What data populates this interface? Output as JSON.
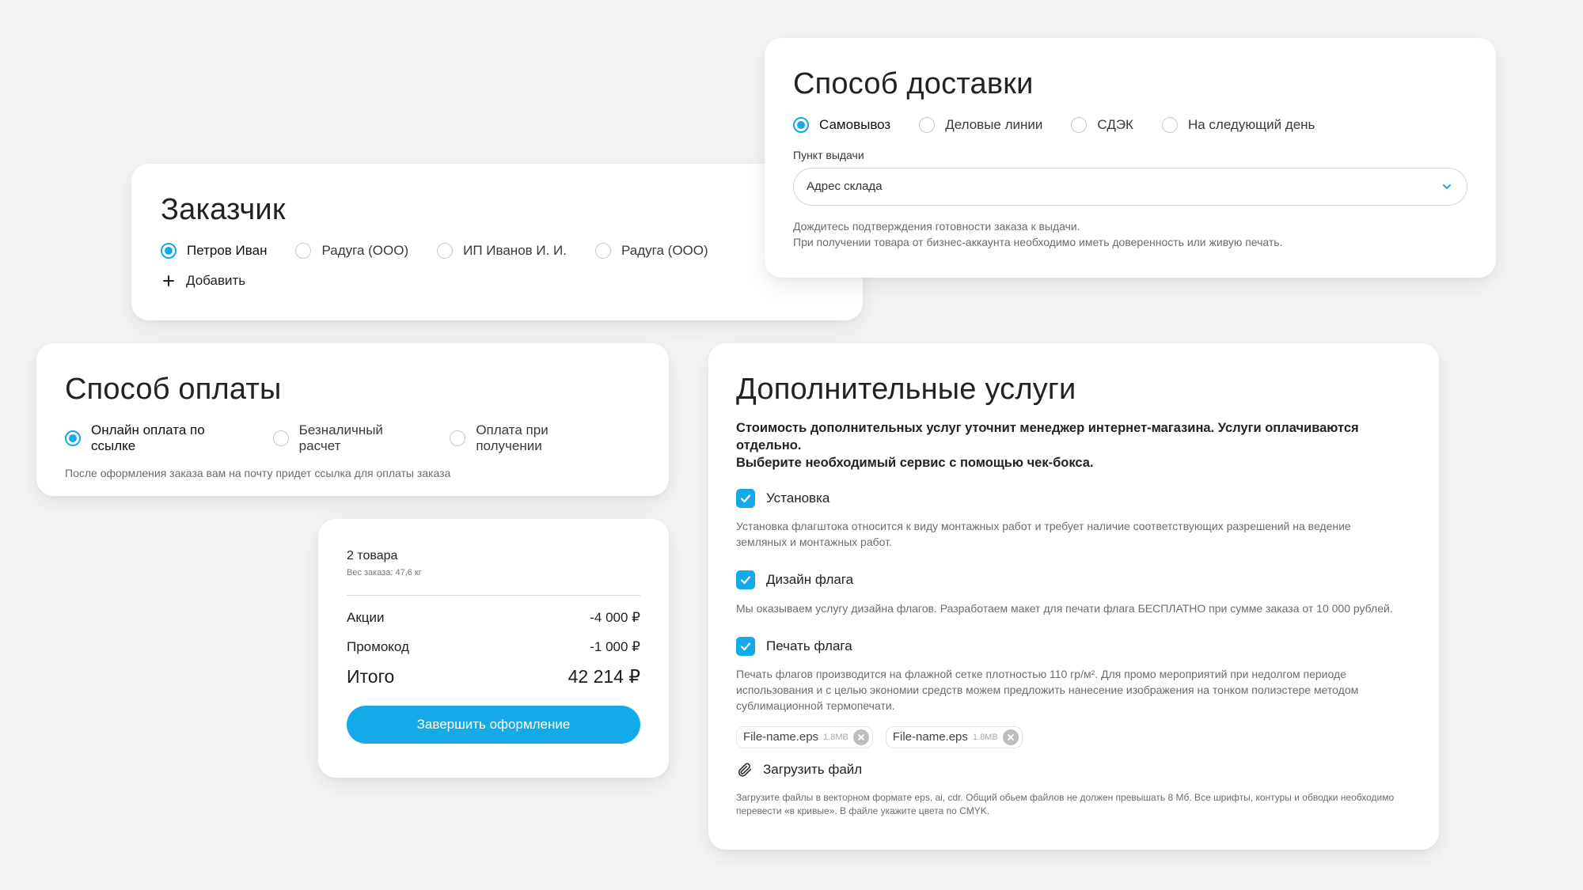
{
  "customer": {
    "title": "Заказчик",
    "options": [
      {
        "label": "Петров Иван",
        "selected": true
      },
      {
        "label": "Радуга (ООО)",
        "selected": false
      },
      {
        "label": "ИП Иванов И. И.",
        "selected": false
      },
      {
        "label": "Радуга (ООО)",
        "selected": false
      }
    ],
    "add_label": "Добавить"
  },
  "delivery": {
    "title": "Способ доставки",
    "options": [
      {
        "label": "Самовывоз",
        "selected": true
      },
      {
        "label": "Деловые линии",
        "selected": false
      },
      {
        "label": "СДЭК",
        "selected": false
      },
      {
        "label": "На следующий день",
        "selected": false
      }
    ],
    "pickup_label": "Пункт выдачи",
    "pickup_value": "Адрес склада",
    "note_1": "Дождитесь подтверждения готовности заказа к выдачи.",
    "note_2": "При получении товара от бизнес-аккаунта необходимо иметь доверенность  или живую печать."
  },
  "payment": {
    "title": "Способ оплаты",
    "options": [
      {
        "label": "Онлайн оплата по ссылке",
        "selected": true
      },
      {
        "label": "Безналичный расчет",
        "selected": false
      },
      {
        "label": "Оплата при получении",
        "selected": false
      }
    ],
    "note": "После оформления заказа вам на почту придет ссылка для оплаты заказа"
  },
  "summary": {
    "items_count": "2 товара",
    "weight": "Вес заказа: 47,6 кг",
    "rows": [
      {
        "label": "Акции",
        "value": "-4 000 ₽"
      },
      {
        "label": "Промокод",
        "value": "-1 000 ₽"
      }
    ],
    "total_label": "Итого",
    "total_value": "42 214 ₽",
    "submit_label": "Завершить оформление"
  },
  "services": {
    "title": "Дополнительные услуги",
    "intro_1": "Стоимость дополнительных услуг уточнит менеджер интернет-магазина. Услуги оплачиваются отдельно.",
    "intro_2": "Выберите необходимый сервис с помощью чек-бокса.",
    "items": [
      {
        "label": "Установка",
        "checked": true,
        "desc_1": "Установка флагштока относится к виду монтажных работ и требует наличие соответствующих разрешений на ведение",
        "desc_2": "земляных и монтажных работ."
      },
      {
        "label": "Дизайн флага",
        "checked": true,
        "desc_1": "Мы оказываем услугу дизайна флагов. Разработаем макет для печати флага БЕСПЛАТНО при сумме заказа от 10 000 рублей."
      },
      {
        "label": "Печать флага",
        "checked": true,
        "desc_1": "Печать флагов производится на флажной сетке плотностью 110 гр/м². Для промо мероприятий при недолгом периоде",
        "desc_2": "использования и с целью экономии средств можем предложить нанесение изображения на тонком полиэстере методом",
        "desc_3": "сублимационной термопечати."
      }
    ],
    "files": [
      {
        "name": "File-name.eps",
        "size": "1.8MB"
      },
      {
        "name": "File-name.eps",
        "size": "1.8MB"
      }
    ],
    "upload_label": "Загрузить файл",
    "upload_note_1": "Загрузите файлы в векторном формате eps, ai, cdr. Общий обьем файлов не должен превышать 8 Мб. Все шрифты, контуры и обводки необходимо",
    "upload_note_2": "перевести «в кривые». В файле укажите цвета по CMYK."
  },
  "colors": {
    "accent": "#14a9e8",
    "background": "#f4f4f4"
  }
}
